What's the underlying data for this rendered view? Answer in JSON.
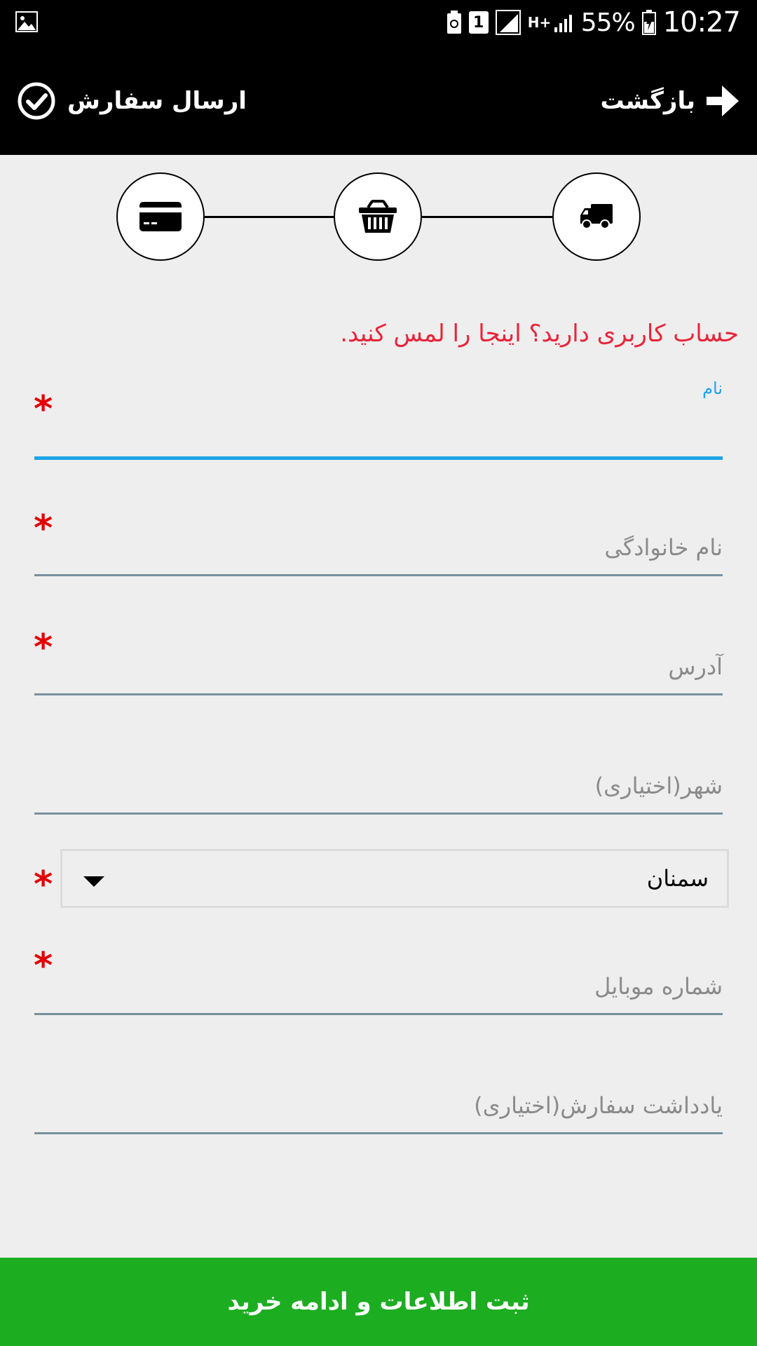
{
  "status_bar": {
    "battery_percent": "55%",
    "time": "10:27",
    "sim_badge": "1",
    "network_type": "H+",
    "icons": [
      "gallery-icon",
      "battery-saver-icon",
      "sim-icon",
      "signal-icon",
      "data-icon",
      "signal-weak-icon",
      "battery-icon"
    ]
  },
  "toolbar": {
    "back_label": "بازگشت",
    "submit_label": "ارسال سفارش",
    "background": "#000000"
  },
  "steps": {
    "items": [
      {
        "name": "payment",
        "icon": "credit-card-icon"
      },
      {
        "name": "basket",
        "icon": "basket-icon"
      },
      {
        "name": "shipping",
        "icon": "truck-icon"
      }
    ]
  },
  "account_link": {
    "text": "حساب کاربری دارید؟ اینجا را لمس کنید.",
    "color": "#e8253b"
  },
  "form": {
    "first_name": {
      "label": "نام",
      "value": "",
      "required": true,
      "active": true
    },
    "last_name": {
      "placeholder": "نام خانوادگی",
      "required": true
    },
    "address": {
      "placeholder": "آدرس",
      "required": true
    },
    "city": {
      "placeholder": "شهر(اختیاری)",
      "required": false
    },
    "province": {
      "selected": "سمنان",
      "required": true
    },
    "mobile": {
      "placeholder": "شماره موبایل",
      "required": true
    },
    "note": {
      "placeholder": "یادداشت سفارش(اختیاری)",
      "required": false
    },
    "required_mark": "*"
  },
  "continue_button": {
    "label": "ثبت اطلاعات و ادامه خرید",
    "color": "#1cad21"
  },
  "colors": {
    "accent_blue": "#1ea4e6",
    "required_red": "#e30000",
    "background": "#eeeeee"
  }
}
